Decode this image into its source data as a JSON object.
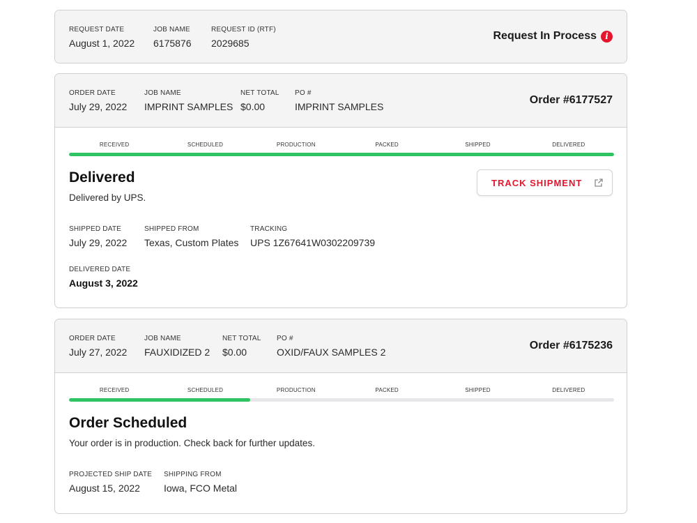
{
  "request": {
    "fields": [
      {
        "label": "REQUEST DATE",
        "value": "August 1, 2022"
      },
      {
        "label": "JOB NAME",
        "value": "6175876"
      },
      {
        "label": "REQUEST ID (RTF)",
        "value": "2029685"
      }
    ],
    "status": "Request In Process",
    "status_icon": "info-icon",
    "accent_color": "#e3162e"
  },
  "steps": [
    "RECEIVED",
    "SCHEDULED",
    "PRODUCTION",
    "PACKED",
    "SHIPPED",
    "DELIVERED"
  ],
  "orders": [
    {
      "fields": [
        {
          "label": "ORDER DATE",
          "value": "July 29, 2022"
        },
        {
          "label": "JOB NAME",
          "value": "IMPRINT SAMPLES"
        },
        {
          "label": "NET TOTAL",
          "value": "$0.00"
        },
        {
          "label": "PO #",
          "value": "IMPRINT SAMPLES"
        }
      ],
      "order_number": "Order #6177527",
      "progress_fraction": 1.0,
      "status_title": "Delivered",
      "status_desc": "Delivered by UPS.",
      "track_button": "TRACK SHIPMENT",
      "track_icon": "external-link-icon",
      "details": [
        {
          "label": "SHIPPED DATE",
          "value": "July 29, 2022"
        },
        {
          "label": "SHIPPED FROM",
          "value": "Texas, Custom Plates"
        },
        {
          "label": "TRACKING",
          "value": "UPS 1Z67641W0302209739"
        }
      ],
      "delivered": {
        "label": "DELIVERED DATE",
        "value": "August 3, 2022"
      }
    },
    {
      "fields": [
        {
          "label": "ORDER DATE",
          "value": "July 27, 2022"
        },
        {
          "label": "JOB NAME",
          "value": "FAUXIDIZED 2"
        },
        {
          "label": "NET TOTAL",
          "value": "$0.00"
        },
        {
          "label": "PO #",
          "value": "OXID/FAUX SAMPLES 2"
        }
      ],
      "order_number": "Order #6175236",
      "progress_fraction": 0.333,
      "status_title": "Order Scheduled",
      "status_desc": "Your order is in production. Check back for further updates.",
      "details": [
        {
          "label": "PROJECTED SHIP DATE",
          "value": "August 15, 2022"
        },
        {
          "label": "SHIPPING FROM",
          "value": "Iowa, FCO Metal"
        }
      ]
    }
  ],
  "colors": {
    "progress": "#2ec363",
    "progress_track": "#e7e7e9",
    "header_bg": "#f4f4f5",
    "border": "#cfcfd2"
  }
}
